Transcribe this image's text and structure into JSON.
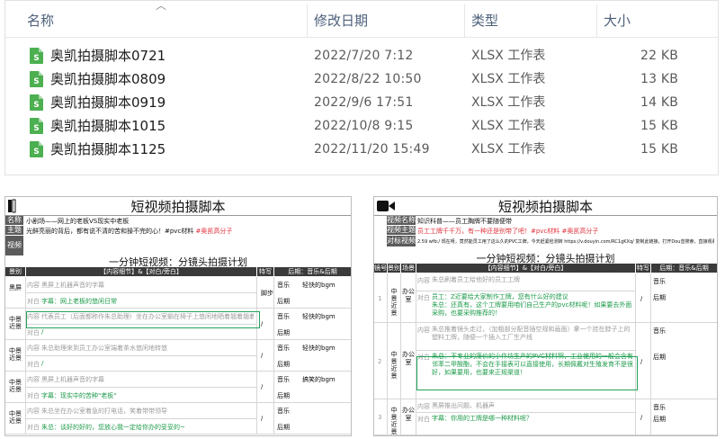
{
  "explorer": {
    "columns": {
      "name": "名称",
      "modified": "修改日期",
      "type": "类型",
      "size": "大小"
    },
    "files": [
      {
        "name": "奥凯拍摄脚本0721",
        "modified": "2022/7/20 7:12",
        "type": "XLSX 工作表",
        "size": "22 KB"
      },
      {
        "name": "奥凯拍摄脚本0809",
        "modified": "2022/8/22 10:50",
        "type": "XLSX 工作表",
        "size": "13 KB"
      },
      {
        "name": "奥凯拍摄脚本0919",
        "modified": "2022/9/6 17:51",
        "type": "XLSX 工作表",
        "size": "14 KB"
      },
      {
        "name": "奥凯拍摄脚本1015",
        "modified": "2022/10/8 9:15",
        "type": "XLSX 工作表",
        "size": "15 KB"
      },
      {
        "name": "奥凯拍摄脚本1125",
        "modified": "2022/11/20 15:49",
        "type": "XLSX 工作表",
        "size": "15 KB"
      }
    ],
    "icon": "excel-file-icon",
    "icon_letter": "S",
    "icon_color": "#4caf50"
  },
  "left_doc": {
    "title": "短视频拍摄脚本",
    "meta": [
      {
        "label": "名称",
        "value": "小剧场——网上的老板VS现实中老板"
      },
      {
        "label": "主题",
        "value": "光鲜亮丽的背后，都有说不清的苦和操不完的心！#pvc材料",
        "tag": "#奥凯高分子"
      },
      {
        "label": "视频",
        "value": ""
      }
    ],
    "plan_title": "一分钟短视频：分镜头拍摄计划",
    "headers": {
      "scene": "景别",
      "content": "【内容细节】&【对白/旁白】",
      "technique": "特写",
      "post": "后期：音乐&后期"
    },
    "rows": [
      {
        "scene": "黑屏",
        "content": "黑屏上机器声音的字幕",
        "line_label": "内容",
        "dialog_label": "对白",
        "dialog": "字幕：网上老板的悠闲日常",
        "tech": "脚步",
        "music": "音乐",
        "music_val": "轻快的bgm",
        "post_label": "后期"
      },
      {
        "scene": "中景近景",
        "content": "代表员工（后面都称作朱总助理）坐在办公室躺在椅子上悠闲地晒着翘着翘着腿",
        "line_label": "内容",
        "dialog_label": "对白",
        "dialog": "/",
        "tech": "/",
        "music": "音乐",
        "music_val": "轻快的bgm",
        "post_label": "后期"
      },
      {
        "scene": "中景近景",
        "content": "朱总助理来到员工办公室端着茶水悠闲地转悠",
        "line_label": "内容",
        "dialog_label": "对白",
        "dialog": "/",
        "tech": "/",
        "music": "音乐",
        "music_val": "轻快的bgm",
        "post_label": "后期"
      },
      {
        "scene": "中景近景",
        "content": "黑屏上机器声音的字幕",
        "line_label": "内容",
        "dialog_label": "对白",
        "dialog": "字幕：现实中的苦种\"老板\"",
        "tech": "/",
        "music": "音乐",
        "music_val": "搞笑的bgm",
        "post_label": "后期"
      },
      {
        "scene": "中景近景",
        "content": "朱总坐在办公室着急的打电话，笑着带带领导",
        "line_label": "内容",
        "dialog_label": "对白",
        "dialog": "朱总：谈好的好的，您放心我一定给你办的妥妥的~",
        "tech": "/",
        "music": "音乐",
        "music_val": "",
        "post_label": "后期"
      }
    ]
  },
  "right_doc": {
    "title": "短视频拍摄脚本",
    "meta": [
      {
        "label": "视频名称",
        "value": "知识科普——员工胸牌不要随便带"
      },
      {
        "label": "视频主题",
        "value": "员工工牌千千万，有一种还是别带了吧！#pvc材料",
        "tag": "#奥凯高分子"
      },
      {
        "label": "对标视频",
        "value": "2.59 wfb:/ 现在呀，竟然能员工用了这么久的PVC工牌，今天赶紧检测转 https://v.douyin.com/RC1gKXq/ 复制此链接，打开Dou音搜索，直接观看视频!"
      }
    ],
    "plan_title": "一分钟短视频：分镜头拍摄计划",
    "headers": {
      "no": "镜号",
      "scene": "景别",
      "place": "场景",
      "content": "【内容细节】&【对白/旁白】",
      "technique": "特写",
      "post": "后期：音乐&后期"
    },
    "rows": [
      {
        "no": "1",
        "scene": "中景近景",
        "place": "办公室",
        "content": "朱总刷着员工给他好的员工工牌",
        "line_label": "内容",
        "dialog_label": "对白",
        "dialog": "员工：Z近要给大家制作工牌，您有什么好的建议\n朱总：还真有，这个工牌要用咱们自己生产的pvc材料呢！如果要去外面采购，也要采购推荐的！",
        "tech": "/",
        "music": "音乐",
        "post_label": "后期"
      },
      {
        "no": "2",
        "scene": "中景近景",
        "place": "办公室",
        "content": "朱总推着镜头走过，（加粗部分配音插空规和画面）拿一个挂在脖子上的塑料工牌，随便一个插入工厂生产线",
        "line_label": "内容",
        "dialog_label": "对白",
        "dialog": "朱总：不专业的廉价的小作坊生产的PVC材料啊，工业使用的一般会含有邻苯二甲酸酯，不会在手接表可以直接使用，长期佩戴对生殖发育不是很好，如果要用，也要来正规渠道！",
        "tech": "/",
        "music": "音乐",
        "post_label": "后期"
      },
      {
        "no": "3",
        "scene": "中景近景",
        "place": "办公室",
        "content": "黑屏推出问题、机器声",
        "line_label": "内容",
        "dialog_label": "对白",
        "dialog": "字幕：你用的工牌是哪一种材料呢？",
        "tech": "/",
        "music": "音乐",
        "post_label": "后期"
      }
    ]
  }
}
